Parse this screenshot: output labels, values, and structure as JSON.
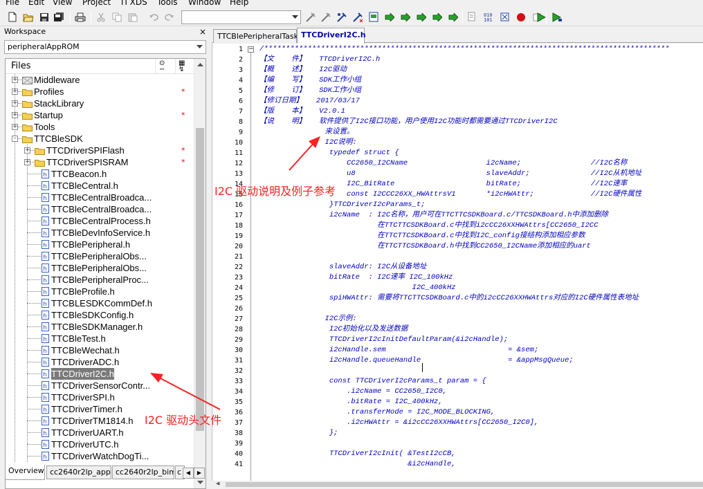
{
  "menu": [
    "File",
    "Edit",
    "View",
    "Project",
    "TI XDS",
    "Tools",
    "Window",
    "Help"
  ],
  "toolbar": {
    "icons": [
      "new-file-icon",
      "open-icon",
      "save-icon",
      "save-all-icon",
      "print-icon",
      "cut-icon",
      "copy-icon",
      "paste-icon",
      "undo-icon",
      "redo-icon",
      "find-combo",
      "toggle-bookmark-icon",
      "next-bookmark-icon",
      "prev-bookmark-icon",
      "clear-bookmarks-icon",
      "find-in-files-icon",
      "go-to-icon",
      "navigate-back-icon",
      "navigate-forward-icon",
      "compile-icon",
      "make-icon",
      "stop-build-icon",
      "debug-icon",
      "debug-without-download-icon"
    ]
  },
  "workspace": {
    "title": "Workspace",
    "config": "peripheralAppROM",
    "files_header": "Files",
    "tree": [
      {
        "label": "Middleware",
        "kind": "folder-special",
        "depth": 1,
        "expand": "+",
        "star": false
      },
      {
        "label": "Profiles",
        "kind": "folder",
        "depth": 1,
        "expand": "+",
        "star": true
      },
      {
        "label": "StackLibrary",
        "kind": "folder",
        "depth": 1,
        "expand": "+",
        "star": false
      },
      {
        "label": "Startup",
        "kind": "folder",
        "depth": 1,
        "expand": "+",
        "star": true
      },
      {
        "label": "Tools",
        "kind": "folder",
        "depth": 1,
        "expand": "+",
        "star": false
      },
      {
        "label": "TTCBleSDK",
        "kind": "folder",
        "depth": 1,
        "expand": "-",
        "star": false
      },
      {
        "label": "TTCDriverSPIFlash",
        "kind": "folder",
        "depth": 2,
        "expand": "+",
        "star": true
      },
      {
        "label": "TTCDriverSPISRAM",
        "kind": "folder",
        "depth": 2,
        "expand": "+",
        "star": true
      },
      {
        "label": "TTCBeacon.h",
        "kind": "file",
        "depth": 2,
        "star": false
      },
      {
        "label": "TTCBleCentral.h",
        "kind": "file",
        "depth": 2,
        "star": false
      },
      {
        "label": "TTCBleCentralBroadca...",
        "kind": "file",
        "depth": 2,
        "star": false
      },
      {
        "label": "TTCBleCentralBroadca...",
        "kind": "file",
        "depth": 2,
        "star": false
      },
      {
        "label": "TTCBleCentralProcess.h",
        "kind": "file",
        "depth": 2,
        "star": false
      },
      {
        "label": "TTCBleDevInfoService.h",
        "kind": "file",
        "depth": 2,
        "star": false
      },
      {
        "label": "TTCBlePeripheral.h",
        "kind": "file",
        "depth": 2,
        "star": false
      },
      {
        "label": "TTCBlePeripheralObs...",
        "kind": "file",
        "depth": 2,
        "star": false
      },
      {
        "label": "TTCBlePeripheralObs...",
        "kind": "file",
        "depth": 2,
        "star": false
      },
      {
        "label": "TTCBlePeripheralProc...",
        "kind": "file",
        "depth": 2,
        "star": false
      },
      {
        "label": "TTCBleProfile.h",
        "kind": "file",
        "depth": 2,
        "star": false
      },
      {
        "label": "TTCBLESDKCommDef.h",
        "kind": "file",
        "depth": 2,
        "star": false
      },
      {
        "label": "TTCBleSDKConfig.h",
        "kind": "file",
        "depth": 2,
        "star": false
      },
      {
        "label": "TTCBleSDKManager.h",
        "kind": "file",
        "depth": 2,
        "star": false
      },
      {
        "label": "TTCBleTest.h",
        "kind": "file",
        "depth": 2,
        "star": false
      },
      {
        "label": "TTCBleWechat.h",
        "kind": "file",
        "depth": 2,
        "star": false
      },
      {
        "label": "TTCDriverADC.h",
        "kind": "file",
        "depth": 2,
        "star": false
      },
      {
        "label": "TTCDriverI2C.h",
        "kind": "file",
        "depth": 2,
        "star": false,
        "selected": true
      },
      {
        "label": "TTCDriverSensorContr...",
        "kind": "file",
        "depth": 2,
        "star": false
      },
      {
        "label": "TTCDriverSPI.h",
        "kind": "file",
        "depth": 2,
        "star": false
      },
      {
        "label": "TTCDriverTimer.h",
        "kind": "file",
        "depth": 2,
        "star": false
      },
      {
        "label": "TTCDriverTM1814.h",
        "kind": "file",
        "depth": 2,
        "star": false
      },
      {
        "label": "TTCDriverUART.h",
        "kind": "file",
        "depth": 2,
        "star": false
      },
      {
        "label": "TTCDriverUTC.h",
        "kind": "file",
        "depth": 2,
        "star": false
      },
      {
        "label": "TTCDriverWatchDogTi...",
        "kind": "file",
        "depth": 2,
        "star": false
      }
    ],
    "tabs": [
      "Overview",
      "cc2640r2lp_app",
      "cc2640r2lp_bim",
      "c"
    ]
  },
  "editor": {
    "tabs": [
      {
        "label": "TTCBlePeripheralTask.c",
        "active": false
      },
      {
        "label": "TTCDriverI2C.h",
        "active": true
      }
    ],
    "lines": [
      {
        "n": "1",
        "t": "/*********************************************************************************************",
        "c": "blue"
      },
      {
        "n": "2",
        "t": "【文    件】   TTCDriverI2C.h",
        "c": "blue"
      },
      {
        "n": "3",
        "t": "【概    述】   I2C驱动",
        "c": "blue"
      },
      {
        "n": "4",
        "t": "【编    写】   SDK工作小组",
        "c": "blue"
      },
      {
        "n": "5",
        "t": "【修    订】   SDK工作小组",
        "c": "blue"
      },
      {
        "n": "6",
        "t": "【修订日期】   2017/03/17",
        "c": "blue"
      },
      {
        "n": "7",
        "t": "【版    本】   V2.0.1",
        "c": "blue"
      },
      {
        "n": "8",
        "t": "【说    明】   软件提供了I2C接口功能，用户使用I2C功能时都需要通过TTCDriverI2C",
        "c": "blue"
      },
      {
        "n": "9",
        "t": "               来设置。",
        "c": "blue"
      },
      {
        "n": "10",
        "t": "               I2C说明:",
        "c": "blue"
      },
      {
        "n": "11",
        "t": "                typedef struct {",
        "c": "blue"
      },
      {
        "n": "12",
        "t": "                    CC2650_I2CName                  i2cName;                //I2C名称",
        "c": "blue"
      },
      {
        "n": "13",
        "t": "                    u8                              slaveAddr;              //I2C从机地址",
        "c": "blue"
      },
      {
        "n": "14",
        "t": "                    I2C_BitRate                     bitRate;                //I2C速率",
        "c": "blue"
      },
      {
        "n": "15",
        "t": "                    const I2CCC26XX_HWAttrsV1       *i2cHWAttr;             //I2C硬件属性",
        "c": "blue"
      },
      {
        "n": "16",
        "t": "                }TTCDriverI2cParams_t;",
        "c": "blue"
      },
      {
        "n": "17",
        "t": "                i2cName  : I2C名称，用户可在TTCTTCSDKBoard.c/TTCSDKBoard.h中添加删除",
        "c": "blue"
      },
      {
        "n": "18",
        "t": "                           在TTCTTCSDKBoard.c中找到i2cCC26XXHWAttrs[CC2650_I2CC",
        "c": "blue"
      },
      {
        "n": "19",
        "t": "                           在TTCTTCSDKBoard.c中找到I2C_config接结构添加相应参数",
        "c": "blue"
      },
      {
        "n": "20",
        "t": "                           在TTCTTCSDKBoard.h中找到CC2650_I2CName添加相应的uart",
        "c": "blue"
      },
      {
        "n": "21",
        "t": "",
        "c": "blue"
      },
      {
        "n": "22",
        "t": "                slaveAddr: I2C从设备地址",
        "c": "blue"
      },
      {
        "n": "23",
        "t": "                bitRate  : I2C速率 I2C_100kHz",
        "c": "blue"
      },
      {
        "n": "24",
        "t": "                                   I2C_400kHz",
        "c": "blue"
      },
      {
        "n": "25",
        "t": "                spiHWAttr: 需要将TTCTTCSDKBoard.c中的i2cCC26XXHWAttrs对应的I2C硬件属性表地址",
        "c": "blue"
      },
      {
        "n": "26",
        "t": "",
        "c": "blue"
      },
      {
        "n": "27",
        "t": "               I2C示例:",
        "c": "blue"
      },
      {
        "n": "28",
        "t": "                I2C初始化以及发送数据",
        "c": "blue"
      },
      {
        "n": "29",
        "t": "                TTCDriverI2cInitDefaultParam(&i2cHandle);",
        "c": "blue"
      },
      {
        "n": "30",
        "t": "                i2cHandle.sem                            = &sem;",
        "c": "blue"
      },
      {
        "n": "31",
        "t": "                i2cHandle.queueHandle                    = &appMsgQueue;",
        "c": "blue"
      },
      {
        "n": "32",
        "t": "",
        "c": "blue"
      },
      {
        "n": "33",
        "t": "                const TTCDriverI2cParams_t param = {",
        "c": "blue"
      },
      {
        "n": "34",
        "t": "                    .i2cName = CC2650_I2C0,",
        "c": "blue"
      },
      {
        "n": "35",
        "t": "                    .bitRate = I2C_400kHz,",
        "c": "blue"
      },
      {
        "n": "36",
        "t": "                    .transferMode = I2C_MODE_BLOCKING,",
        "c": "blue"
      },
      {
        "n": "37",
        "t": "                    .i2cHWAttr = &i2cCC26XXHWAttrs[CC2650_I2C0],",
        "c": "blue"
      },
      {
        "n": "38",
        "t": "                };",
        "c": "blue"
      },
      {
        "n": "39",
        "t": "",
        "c": "blue"
      },
      {
        "n": "40",
        "t": "                TTCDriverI2cInit( &TestI2cCB,",
        "c": "blue"
      },
      {
        "n": "41",
        "t": "                                  &i2cHandle,",
        "c": "blue"
      }
    ]
  },
  "annotations": {
    "code_note": "I2C 驱动说明及例子参考",
    "file_note": "I2C 驱动头文件"
  },
  "colors": {
    "annotation_red": "#ff2020",
    "code_blue": "#0000c0",
    "selection_gray": "#7a7a7a",
    "active_tab_text": "#0000aa"
  }
}
